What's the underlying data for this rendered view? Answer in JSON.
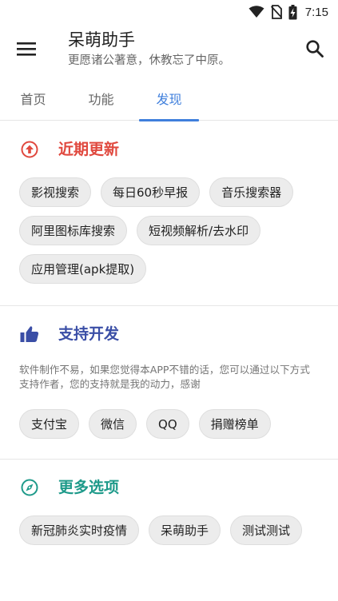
{
  "status_bar": {
    "time": "7:15"
  },
  "app_bar": {
    "title": "呆萌助手",
    "subtitle": "更愿诸公著意，休教忘了中原。"
  },
  "tabs": [
    {
      "label": "首页"
    },
    {
      "label": "功能"
    },
    {
      "label": "发现",
      "active": true
    }
  ],
  "sections": {
    "recent": {
      "title": "近期更新",
      "color": "#e0483e",
      "icon": "arrow-up-circle-icon",
      "chips": [
        "影视搜索",
        "每日60秒早报",
        "音乐搜索器",
        "阿里图标库搜索",
        "短视频解析/去水印",
        "应用管理(apk提取)"
      ]
    },
    "support": {
      "title": "支持开发",
      "color": "#3a4ea6",
      "icon": "thumbs-up-icon",
      "description": "软件制作不易，如果您觉得本APP不错的话，您可以通过以下方式支持作者，您的支持就是我的动力，感谢",
      "chips": [
        "支付宝",
        "微信",
        "QQ",
        "捐赠榜单"
      ]
    },
    "more": {
      "title": "更多选项",
      "color": "#1e9a8a",
      "icon": "compass-icon",
      "chips": [
        "新冠肺炎实时疫情",
        "呆萌助手",
        "测试测试"
      ]
    }
  },
  "colors": {
    "accent": "#3f7fdc"
  }
}
